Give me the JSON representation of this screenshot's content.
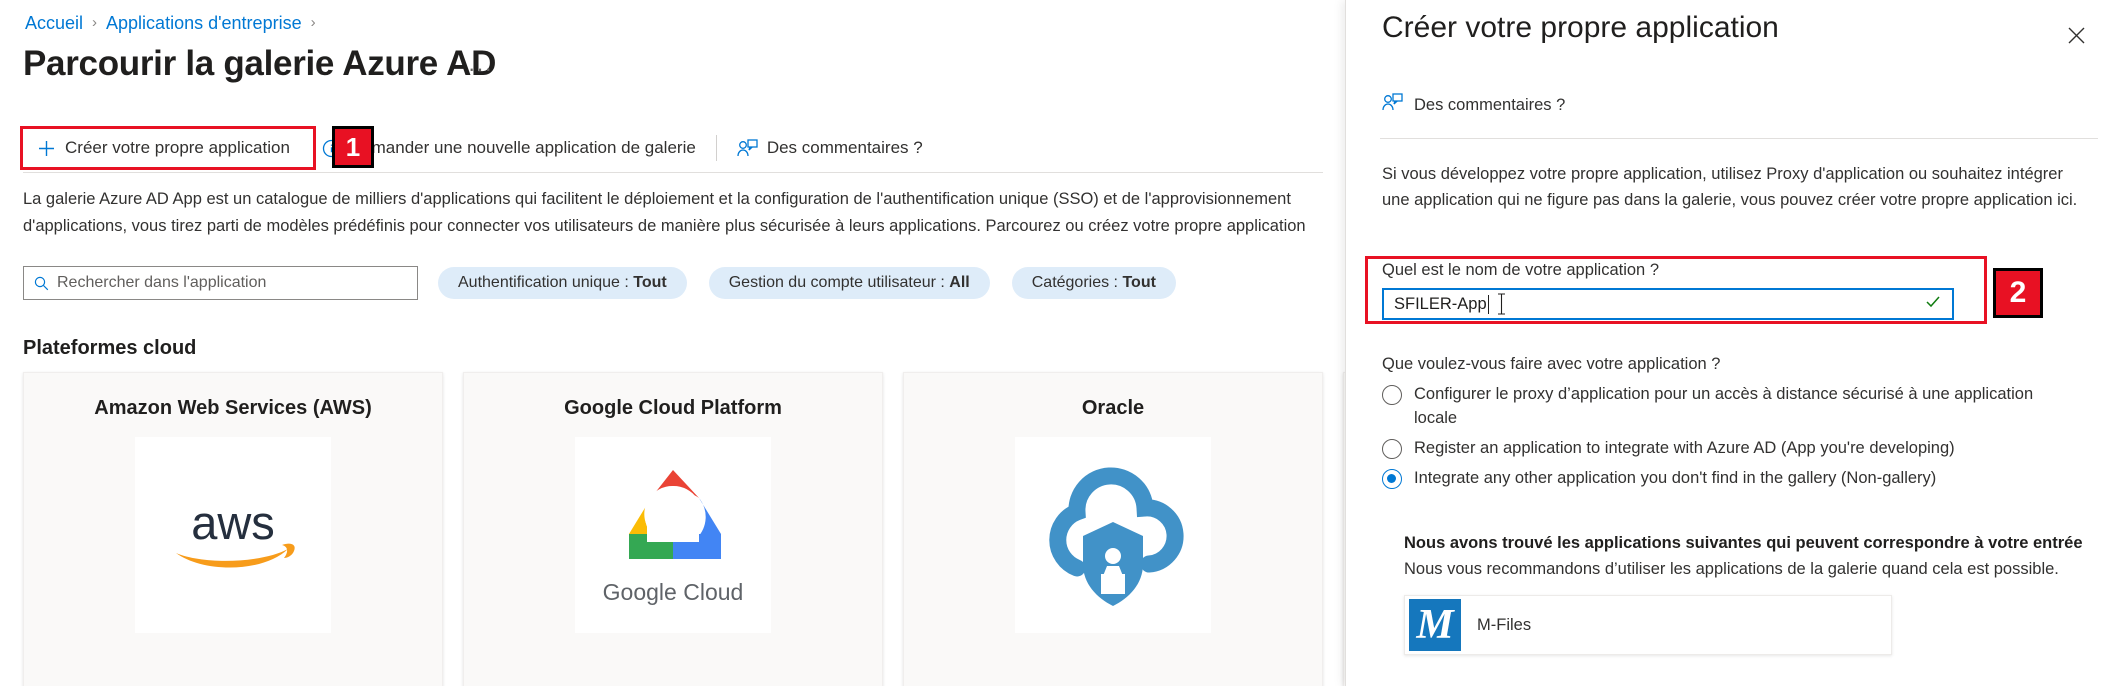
{
  "breadcrumb": {
    "items": [
      {
        "label": "Accueil"
      },
      {
        "label": "Applications d'entreprise"
      }
    ],
    "separator": "›"
  },
  "page": {
    "title": "Parcourir la galerie Azure AD",
    "ellipsis": "···"
  },
  "commandbar": {
    "create_own_app": "Créer votre propre application",
    "create_own_app_icon": "plus-icon",
    "request_gallery_app": "Demander une nouvelle application de galerie",
    "request_gallery_app_icon": "info-icon",
    "feedback": "Des commentaires ?",
    "feedback_icon": "feedback-person-icon"
  },
  "annotations": {
    "badge1": "1",
    "badge2": "2",
    "highlight_color": "#e81123"
  },
  "description": "La galerie Azure AD App est un catalogue de milliers d'applications qui facilitent le déploiement et la configuration de l'authentification unique (SSO) et de l'approvisionnement d'applications, vous tirez parti de modèles prédéfinis pour connecter vos utilisateurs de manière plus sécurisée à leurs applications. Parcourez ou créez votre propre application",
  "search": {
    "placeholder": "Rechercher dans l'application",
    "icon": "search-icon"
  },
  "filters": [
    {
      "label": "Authentification unique :",
      "value": "Tout"
    },
    {
      "label": "Gestion du compte utilisateur :",
      "value": "All"
    },
    {
      "label": "Catégories :",
      "value": "Tout"
    }
  ],
  "gallery": {
    "section_title": "Plateformes cloud",
    "cards": [
      {
        "title": "Amazon Web Services (AWS)",
        "logo": "aws-logo"
      },
      {
        "title": "Google Cloud Platform",
        "logo": "google-cloud-logo"
      },
      {
        "title": "Oracle",
        "logo": "oracle-cloud-logo"
      },
      {
        "title": "",
        "logo": ""
      }
    ]
  },
  "panel": {
    "title": "Créer votre propre application",
    "close_icon": "close-icon",
    "feedback": "Des commentaires ?",
    "feedback_icon": "feedback-person-icon",
    "description": "Si vous développez votre propre application, utilisez Proxy d'application ou souhaitez intégrer une application qui ne figure pas dans la galerie, vous pouvez créer votre propre application ici.",
    "name_label": "Quel est le nom de votre application ?",
    "name_value": "SFILER-App",
    "name_valid_icon": "checkmark-icon",
    "action_label": "Que voulez-vous faire avec votre application ?",
    "options": [
      {
        "label": "Configurer le proxy d’application pour un accès à distance sécurisé à une application locale",
        "selected": false
      },
      {
        "label": "Register an application to integrate with Azure AD (App you're developing)",
        "selected": false
      },
      {
        "label": "Integrate any other application you don't find in the gallery (Non-gallery)",
        "selected": true
      }
    ],
    "recommendation": {
      "title": "Nous avons trouvé les applications suivantes qui peuvent correspondre à votre entrée",
      "subtitle": "Nous vous recommandons d’utiliser les applications de la galerie quand cela est possible.",
      "items": [
        {
          "name": "M-Files",
          "logo_letter": "M",
          "logo_color": "#1577bd"
        }
      ]
    }
  }
}
